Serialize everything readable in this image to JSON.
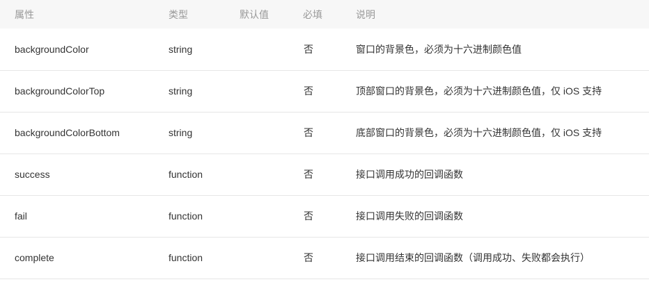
{
  "table": {
    "headers": [
      "属性",
      "类型",
      "默认值",
      "必填",
      "说明"
    ],
    "rows": [
      {
        "name": "backgroundColor",
        "type": "string",
        "default": "",
        "required": "否",
        "desc": "窗口的背景色，必须为十六进制颜色值"
      },
      {
        "name": "backgroundColorTop",
        "type": "string",
        "default": "",
        "required": "否",
        "desc": "顶部窗口的背景色，必须为十六进制颜色值，仅 iOS 支持"
      },
      {
        "name": "backgroundColorBottom",
        "type": "string",
        "default": "",
        "required": "否",
        "desc": "底部窗口的背景色，必须为十六进制颜色值，仅 iOS 支持"
      },
      {
        "name": "success",
        "type": "function",
        "default": "",
        "required": "否",
        "desc": "接口调用成功的回调函数"
      },
      {
        "name": "fail",
        "type": "function",
        "default": "",
        "required": "否",
        "desc": "接口调用失败的回调函数"
      },
      {
        "name": "complete",
        "type": "function",
        "default": "",
        "required": "否",
        "desc": "接口调用结束的回调函数（调用成功、失败都会执行）"
      }
    ]
  }
}
